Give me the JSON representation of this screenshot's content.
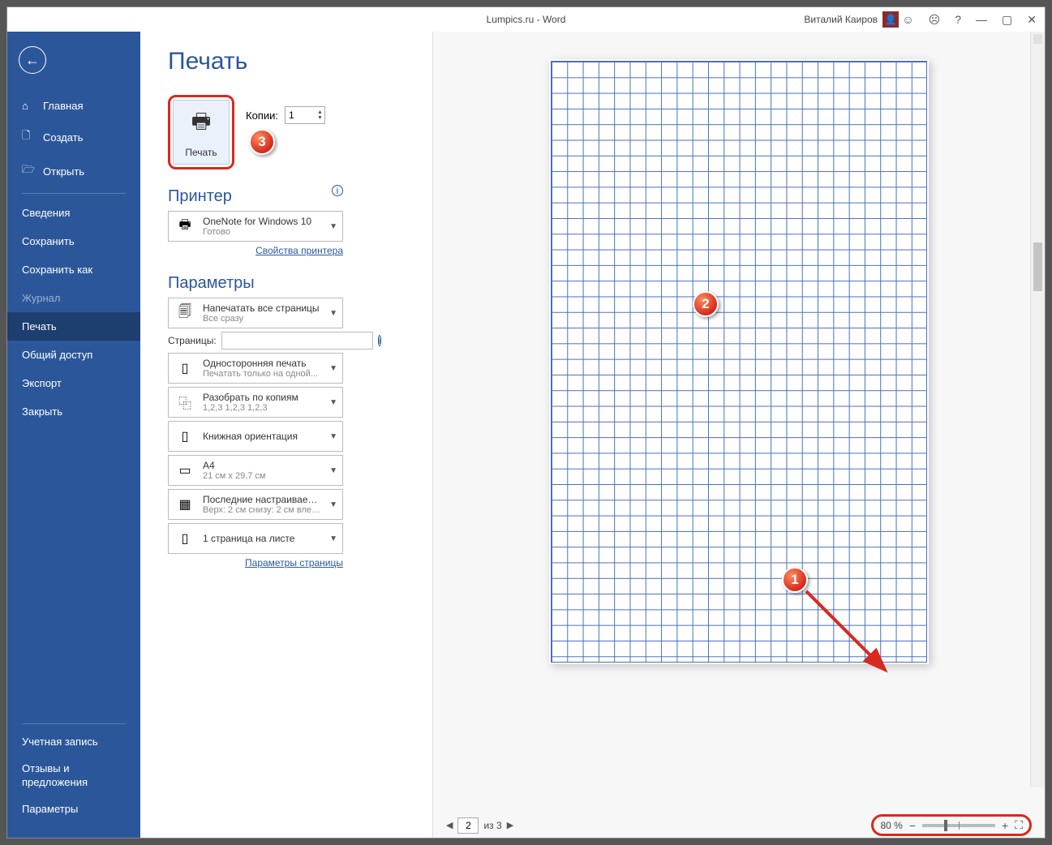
{
  "title_bar": {
    "doc_title": "Lumpics.ru - Word",
    "user_name": "Виталий Каиров"
  },
  "sidebar": {
    "top": [
      {
        "label": "Главная"
      },
      {
        "label": "Создать"
      },
      {
        "label": "Открыть"
      }
    ],
    "mid": [
      {
        "label": "Сведения"
      },
      {
        "label": "Сохранить"
      },
      {
        "label": "Сохранить как"
      },
      {
        "label": "Журнал",
        "disabled": true
      },
      {
        "label": "Печать",
        "selected": true
      },
      {
        "label": "Общий доступ"
      },
      {
        "label": "Экспорт"
      },
      {
        "label": "Закрыть"
      }
    ],
    "bottom": [
      {
        "label": "Учетная запись"
      },
      {
        "label": "Отзывы и предложения"
      },
      {
        "label": "Параметры"
      }
    ]
  },
  "print": {
    "page_title": "Печать",
    "print_btn": "Печать",
    "copies_label": "Копии:",
    "copies_value": "1",
    "printer_section": "Принтер",
    "printer_name": "OneNote for Windows 10",
    "printer_status": "Готово",
    "printer_props": "Свойства принтера",
    "params_section": "Параметры",
    "pages_label": "Страницы:",
    "page_params_link": "Параметры страницы",
    "dd_print_all": {
      "t1": "Напечатать все страницы",
      "t2": "Все сразу"
    },
    "dd_sides": {
      "t1": "Односторонняя печать",
      "t2": "Печатать только на одной..."
    },
    "dd_collate": {
      "t1": "Разобрать по копиям",
      "t2": "1,2,3   1,2,3   1,2,3"
    },
    "dd_orient": {
      "t1": "Книжная ориентация",
      "t2": ""
    },
    "dd_size": {
      "t1": "A4",
      "t2": "21 см x 29,7 см"
    },
    "dd_margins": {
      "t1": "Последние настраиваемы...",
      "t2": "Верх: 2 см снизу: 2 см влев..."
    },
    "dd_sheet": {
      "t1": "1 страница на листе",
      "t2": ""
    }
  },
  "footer": {
    "page_current": "2",
    "page_total": "из 3",
    "zoom": "80 %"
  }
}
